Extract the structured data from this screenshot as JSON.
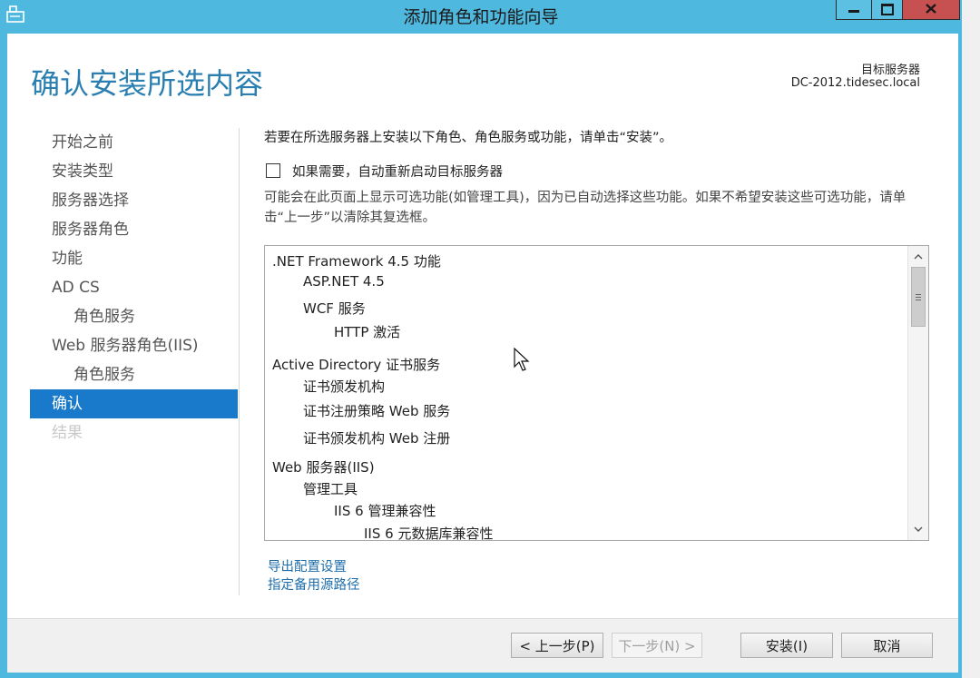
{
  "window": {
    "title": "添加角色和功能向导",
    "minimize_icon": "minimize-icon",
    "maximize_icon": "maximize-icon",
    "close_icon": "close-icon",
    "frame_color": "#4fb8de"
  },
  "header": {
    "page_title": "确认安装所选内容",
    "target_server_label": "目标服务器",
    "target_server_value": "DC-2012.tidesec.local"
  },
  "nav": {
    "items": [
      {
        "label": "开始之前",
        "level": 0,
        "state": "normal"
      },
      {
        "label": "安装类型",
        "level": 0,
        "state": "normal"
      },
      {
        "label": "服务器选择",
        "level": 0,
        "state": "normal"
      },
      {
        "label": "服务器角色",
        "level": 0,
        "state": "normal"
      },
      {
        "label": "功能",
        "level": 0,
        "state": "normal"
      },
      {
        "label": "AD CS",
        "level": 0,
        "state": "normal"
      },
      {
        "label": "角色服务",
        "level": 1,
        "state": "normal"
      },
      {
        "label": "Web 服务器角色(IIS)",
        "level": 0,
        "state": "normal"
      },
      {
        "label": "角色服务",
        "level": 1,
        "state": "normal"
      },
      {
        "label": "确认",
        "level": 0,
        "state": "active"
      },
      {
        "label": "结果",
        "level": 0,
        "state": "disabled"
      }
    ],
    "active_color": "#1979ca"
  },
  "main": {
    "intro": "若要在所选服务器上安装以下角色、角色服务或功能，请单击“安装”。",
    "restart_checkbox": {
      "label": "如果需要，自动重新启动目标服务器",
      "checked": false
    },
    "note": "可能会在此页面上显示可选功能(如管理工具)，因为已自动选择这些功能。如果不希望安装这些可选功能，请单击“上一步”以清除其复选框。",
    "features": [
      {
        "label": ".NET Framework 4.5 功能",
        "level": 0
      },
      {
        "label": "ASP.NET 4.5",
        "level": 1
      },
      {
        "label": "WCF 服务",
        "level": 1
      },
      {
        "label": "HTTP 激活",
        "level": 2
      },
      {
        "label": "Active Directory 证书服务",
        "level": 0
      },
      {
        "label": "证书颁发机构",
        "level": 1
      },
      {
        "label": "证书注册策略 Web 服务",
        "level": 1
      },
      {
        "label": "证书颁发机构 Web 注册",
        "level": 1
      },
      {
        "label": "Web 服务器(IIS)",
        "level": 0
      },
      {
        "label": "管理工具",
        "level": 1
      },
      {
        "label": "IIS 6 管理兼容性",
        "level": 2
      },
      {
        "label": "IIS 6 元数据库兼容性",
        "level": 3
      }
    ],
    "scroll_up_icon": "chevron-up-icon",
    "scroll_down_icon": "chevron-down-icon",
    "links": {
      "export": "导出配置设置",
      "alt_source": "指定备用源路径"
    }
  },
  "footer": {
    "prev": "< 上一步(P)",
    "next": "下一步(N) >",
    "install": "安装(I)",
    "cancel": "取消"
  }
}
